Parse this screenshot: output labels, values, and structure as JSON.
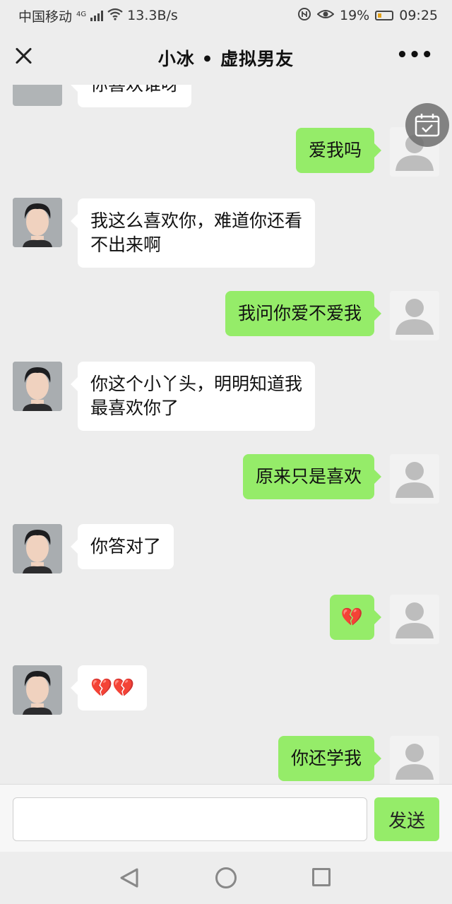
{
  "status_bar": {
    "carrier": "中国移动",
    "network": "4G",
    "speed": "13.3B/s",
    "battery": "19%",
    "time": "09:25"
  },
  "header": {
    "title": "小冰 • 虚拟男友",
    "more_label": "•••"
  },
  "messages": [
    {
      "from": "bot",
      "text": "你喜欢谁呀"
    },
    {
      "from": "user",
      "text": "爱我吗"
    },
    {
      "from": "bot",
      "text": "我这么喜欢你，难道你还看不出来啊"
    },
    {
      "from": "user",
      "text": "我问你爱不爱我"
    },
    {
      "from": "bot",
      "text": "你这个小丫头，明明知道我最喜欢你了"
    },
    {
      "from": "user",
      "text": "原来只是喜欢"
    },
    {
      "from": "bot",
      "text": "你答对了"
    },
    {
      "from": "user",
      "text": "💔"
    },
    {
      "from": "bot",
      "text": "💔💔"
    },
    {
      "from": "user",
      "text": "你还学我"
    }
  ],
  "input": {
    "placeholder": "",
    "send_label": "发送"
  },
  "colors": {
    "background": "#ededed",
    "user_bubble": "#95ec69",
    "bot_bubble": "#ffffff",
    "broken_heart": "#d42b2b"
  },
  "icons": [
    "close-icon",
    "more-icon",
    "calendar-icon",
    "back-icon",
    "home-icon",
    "recent-apps-icon",
    "wifi-icon",
    "signal-icon",
    "battery-icon"
  ]
}
